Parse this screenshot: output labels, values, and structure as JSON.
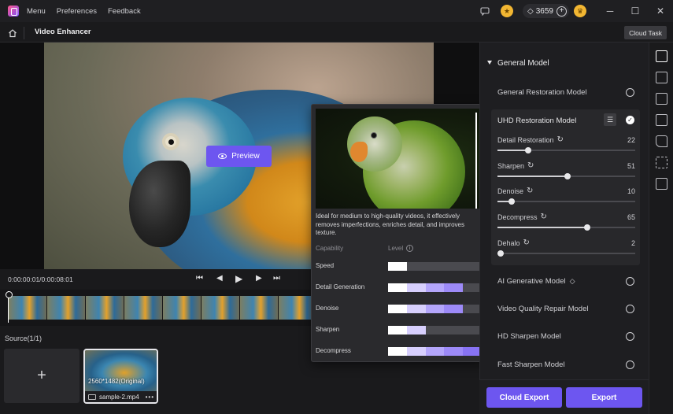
{
  "titlebar": {
    "menus": [
      "Menu",
      "Preferences",
      "Feedback"
    ],
    "credits": "3659",
    "icons": [
      "app-logo",
      "chat-icon",
      "coin-icon",
      "diamond-icon",
      "plus-icon",
      "premium-icon",
      "minimize-icon",
      "maximize-icon",
      "close-icon"
    ]
  },
  "subheader": {
    "title": "Video Enhancer",
    "cloud_task": "Cloud Task"
  },
  "preview": {
    "button_label": "Preview"
  },
  "player": {
    "timecode": "0:00:00:01/0:00:08:01"
  },
  "source": {
    "label": "Source(1/1)",
    "add_label": "+",
    "file": {
      "resolution": "2560*1482(Original)",
      "name": "sample-2.mp4"
    }
  },
  "popup": {
    "description": "Ideal for medium to high-quality videos, it effectively removes imperfections, enriches detail, and improves texture.",
    "col_capability": "Capability",
    "col_level": "Level",
    "capabilities": [
      {
        "label": "Speed",
        "level": 1
      },
      {
        "label": "Detail Generation",
        "level": 4
      },
      {
        "label": "Denoise",
        "level": 4
      },
      {
        "label": "Sharpen",
        "level": 2
      },
      {
        "label": "Decompress",
        "level": 5
      }
    ],
    "max_level": 5
  },
  "panel": {
    "section_title": "General Model",
    "models": [
      "General Restoration Model",
      "UHD Restoration Model",
      "AI Generative Model",
      "Video Quality Repair Model",
      "HD Sharpen Model",
      "Fast Sharpen Model"
    ],
    "selected_model": "UHD Restoration Model",
    "params": [
      {
        "label": "Detail Restoration",
        "value": 22
      },
      {
        "label": "Sharpen",
        "value": 51
      },
      {
        "label": "Denoise",
        "value": 10
      },
      {
        "label": "Decompress",
        "value": 65
      },
      {
        "label": "Dehalo",
        "value": 2
      }
    ]
  },
  "actions": {
    "cloud_export": "Cloud Export",
    "export": "Export"
  },
  "colors": {
    "accent": "#6d56f0",
    "background": "#1a1a1c",
    "panel": "#1e1e21"
  }
}
